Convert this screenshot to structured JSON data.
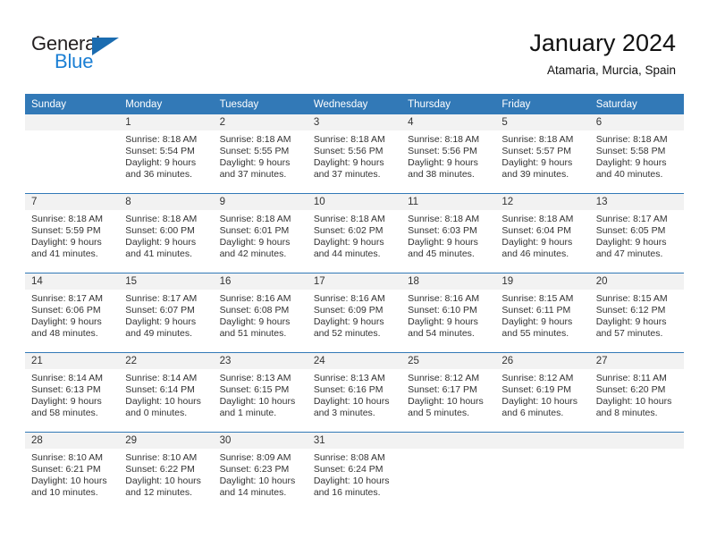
{
  "brand": {
    "name_part1": "General",
    "name_part2": "Blue",
    "triangle_icon": "triangle-icon",
    "accent_blue": "#1b7fd4",
    "header_blue": "#3279b7"
  },
  "header": {
    "title": "January 2024",
    "subtitle": "Atamaria, Murcia, Spain"
  },
  "weekdays": [
    "Sunday",
    "Monday",
    "Tuesday",
    "Wednesday",
    "Thursday",
    "Friday",
    "Saturday"
  ],
  "weeks": [
    [
      {
        "day": "",
        "lines": []
      },
      {
        "day": "1",
        "lines": [
          "Sunrise: 8:18 AM",
          "Sunset: 5:54 PM",
          "Daylight: 9 hours",
          "and 36 minutes."
        ]
      },
      {
        "day": "2",
        "lines": [
          "Sunrise: 8:18 AM",
          "Sunset: 5:55 PM",
          "Daylight: 9 hours",
          "and 37 minutes."
        ]
      },
      {
        "day": "3",
        "lines": [
          "Sunrise: 8:18 AM",
          "Sunset: 5:56 PM",
          "Daylight: 9 hours",
          "and 37 minutes."
        ]
      },
      {
        "day": "4",
        "lines": [
          "Sunrise: 8:18 AM",
          "Sunset: 5:56 PM",
          "Daylight: 9 hours",
          "and 38 minutes."
        ]
      },
      {
        "day": "5",
        "lines": [
          "Sunrise: 8:18 AM",
          "Sunset: 5:57 PM",
          "Daylight: 9 hours",
          "and 39 minutes."
        ]
      },
      {
        "day": "6",
        "lines": [
          "Sunrise: 8:18 AM",
          "Sunset: 5:58 PM",
          "Daylight: 9 hours",
          "and 40 minutes."
        ]
      }
    ],
    [
      {
        "day": "7",
        "lines": [
          "Sunrise: 8:18 AM",
          "Sunset: 5:59 PM",
          "Daylight: 9 hours",
          "and 41 minutes."
        ]
      },
      {
        "day": "8",
        "lines": [
          "Sunrise: 8:18 AM",
          "Sunset: 6:00 PM",
          "Daylight: 9 hours",
          "and 41 minutes."
        ]
      },
      {
        "day": "9",
        "lines": [
          "Sunrise: 8:18 AM",
          "Sunset: 6:01 PM",
          "Daylight: 9 hours",
          "and 42 minutes."
        ]
      },
      {
        "day": "10",
        "lines": [
          "Sunrise: 8:18 AM",
          "Sunset: 6:02 PM",
          "Daylight: 9 hours",
          "and 44 minutes."
        ]
      },
      {
        "day": "11",
        "lines": [
          "Sunrise: 8:18 AM",
          "Sunset: 6:03 PM",
          "Daylight: 9 hours",
          "and 45 minutes."
        ]
      },
      {
        "day": "12",
        "lines": [
          "Sunrise: 8:18 AM",
          "Sunset: 6:04 PM",
          "Daylight: 9 hours",
          "and 46 minutes."
        ]
      },
      {
        "day": "13",
        "lines": [
          "Sunrise: 8:17 AM",
          "Sunset: 6:05 PM",
          "Daylight: 9 hours",
          "and 47 minutes."
        ]
      }
    ],
    [
      {
        "day": "14",
        "lines": [
          "Sunrise: 8:17 AM",
          "Sunset: 6:06 PM",
          "Daylight: 9 hours",
          "and 48 minutes."
        ]
      },
      {
        "day": "15",
        "lines": [
          "Sunrise: 8:17 AM",
          "Sunset: 6:07 PM",
          "Daylight: 9 hours",
          "and 49 minutes."
        ]
      },
      {
        "day": "16",
        "lines": [
          "Sunrise: 8:16 AM",
          "Sunset: 6:08 PM",
          "Daylight: 9 hours",
          "and 51 minutes."
        ]
      },
      {
        "day": "17",
        "lines": [
          "Sunrise: 8:16 AM",
          "Sunset: 6:09 PM",
          "Daylight: 9 hours",
          "and 52 minutes."
        ]
      },
      {
        "day": "18",
        "lines": [
          "Sunrise: 8:16 AM",
          "Sunset: 6:10 PM",
          "Daylight: 9 hours",
          "and 54 minutes."
        ]
      },
      {
        "day": "19",
        "lines": [
          "Sunrise: 8:15 AM",
          "Sunset: 6:11 PM",
          "Daylight: 9 hours",
          "and 55 minutes."
        ]
      },
      {
        "day": "20",
        "lines": [
          "Sunrise: 8:15 AM",
          "Sunset: 6:12 PM",
          "Daylight: 9 hours",
          "and 57 minutes."
        ]
      }
    ],
    [
      {
        "day": "21",
        "lines": [
          "Sunrise: 8:14 AM",
          "Sunset: 6:13 PM",
          "Daylight: 9 hours",
          "and 58 minutes."
        ]
      },
      {
        "day": "22",
        "lines": [
          "Sunrise: 8:14 AM",
          "Sunset: 6:14 PM",
          "Daylight: 10 hours",
          "and 0 minutes."
        ]
      },
      {
        "day": "23",
        "lines": [
          "Sunrise: 8:13 AM",
          "Sunset: 6:15 PM",
          "Daylight: 10 hours",
          "and 1 minute."
        ]
      },
      {
        "day": "24",
        "lines": [
          "Sunrise: 8:13 AM",
          "Sunset: 6:16 PM",
          "Daylight: 10 hours",
          "and 3 minutes."
        ]
      },
      {
        "day": "25",
        "lines": [
          "Sunrise: 8:12 AM",
          "Sunset: 6:17 PM",
          "Daylight: 10 hours",
          "and 5 minutes."
        ]
      },
      {
        "day": "26",
        "lines": [
          "Sunrise: 8:12 AM",
          "Sunset: 6:19 PM",
          "Daylight: 10 hours",
          "and 6 minutes."
        ]
      },
      {
        "day": "27",
        "lines": [
          "Sunrise: 8:11 AM",
          "Sunset: 6:20 PM",
          "Daylight: 10 hours",
          "and 8 minutes."
        ]
      }
    ],
    [
      {
        "day": "28",
        "lines": [
          "Sunrise: 8:10 AM",
          "Sunset: 6:21 PM",
          "Daylight: 10 hours",
          "and 10 minutes."
        ]
      },
      {
        "day": "29",
        "lines": [
          "Sunrise: 8:10 AM",
          "Sunset: 6:22 PM",
          "Daylight: 10 hours",
          "and 12 minutes."
        ]
      },
      {
        "day": "30",
        "lines": [
          "Sunrise: 8:09 AM",
          "Sunset: 6:23 PM",
          "Daylight: 10 hours",
          "and 14 minutes."
        ]
      },
      {
        "day": "31",
        "lines": [
          "Sunrise: 8:08 AM",
          "Sunset: 6:24 PM",
          "Daylight: 10 hours",
          "and 16 minutes."
        ]
      },
      {
        "day": "",
        "lines": []
      },
      {
        "day": "",
        "lines": []
      },
      {
        "day": "",
        "lines": []
      }
    ]
  ]
}
